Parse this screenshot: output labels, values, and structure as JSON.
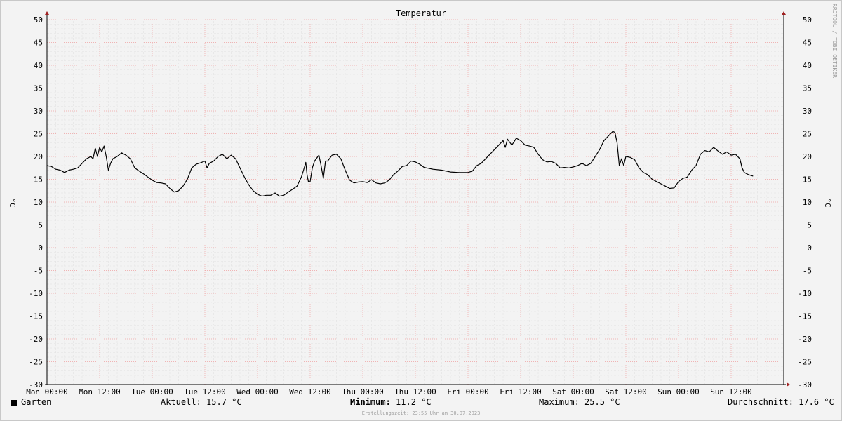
{
  "chart_data": {
    "type": "line",
    "title": "Temperatur",
    "ylabel": "°C",
    "ylabel_right": "°C",
    "watermark": "RRDTOOL / TOBI OETIKER",
    "ylim": [
      -30,
      50
    ],
    "yticks": [
      50,
      45,
      40,
      35,
      30,
      25,
      20,
      15,
      10,
      5,
      0,
      -5,
      -10,
      -15,
      -20,
      -25,
      -30
    ],
    "x_range_hours": [
      0,
      168
    ],
    "xticks": [
      {
        "label": "Mon 00:00",
        "hour": 0
      },
      {
        "label": "Mon 12:00",
        "hour": 12
      },
      {
        "label": "Tue 00:00",
        "hour": 24
      },
      {
        "label": "Tue 12:00",
        "hour": 36
      },
      {
        "label": "Wed 00:00",
        "hour": 48
      },
      {
        "label": "Wed 12:00",
        "hour": 60
      },
      {
        "label": "Thu 00:00",
        "hour": 72
      },
      {
        "label": "Thu 12:00",
        "hour": 84
      },
      {
        "label": "Fri 00:00",
        "hour": 96
      },
      {
        "label": "Fri 12:00",
        "hour": 108
      },
      {
        "label": "Sat 00:00",
        "hour": 120
      },
      {
        "label": "Sat 12:00",
        "hour": 132
      },
      {
        "label": "Sun 00:00",
        "hour": 144
      },
      {
        "label": "Sun 12:00",
        "hour": 156
      }
    ],
    "grid": true,
    "colors": {
      "grid_major": "#f0a0a0",
      "grid_minor": "#e2e2e2",
      "line": "#000000",
      "axis": "#000000",
      "arrow": "#a02020"
    },
    "series": [
      {
        "name": "Garten",
        "points": [
          [
            0,
            18.0
          ],
          [
            1,
            17.8
          ],
          [
            2,
            17.2
          ],
          [
            3,
            17.0
          ],
          [
            4,
            16.5
          ],
          [
            5,
            17.0
          ],
          [
            6,
            17.2
          ],
          [
            7,
            17.5
          ],
          [
            8,
            18.5
          ],
          [
            9,
            19.5
          ],
          [
            10,
            20.0
          ],
          [
            10.5,
            19.5
          ],
          [
            11,
            21.8
          ],
          [
            11.5,
            20.0
          ],
          [
            12,
            22.0
          ],
          [
            12.5,
            21.0
          ],
          [
            13,
            22.3
          ],
          [
            13.5,
            20.0
          ],
          [
            14,
            17.0
          ],
          [
            14.5,
            18.5
          ],
          [
            15,
            19.5
          ],
          [
            16,
            20.0
          ],
          [
            17,
            20.8
          ],
          [
            18,
            20.3
          ],
          [
            19,
            19.5
          ],
          [
            20,
            17.5
          ],
          [
            21,
            16.8
          ],
          [
            22,
            16.2
          ],
          [
            23,
            15.5
          ],
          [
            24,
            14.8
          ],
          [
            25,
            14.3
          ],
          [
            26,
            14.2
          ],
          [
            27,
            14.0
          ],
          [
            28,
            13.0
          ],
          [
            29,
            12.2
          ],
          [
            30,
            12.5
          ],
          [
            31,
            13.5
          ],
          [
            32,
            15.0
          ],
          [
            33,
            17.5
          ],
          [
            34,
            18.3
          ],
          [
            35,
            18.6
          ],
          [
            36,
            19.0
          ],
          [
            36.5,
            17.5
          ],
          [
            37,
            18.5
          ],
          [
            38,
            19.0
          ],
          [
            39,
            20.0
          ],
          [
            40,
            20.5
          ],
          [
            41,
            19.5
          ],
          [
            42,
            20.3
          ],
          [
            43,
            19.5
          ],
          [
            44,
            17.5
          ],
          [
            45,
            15.5
          ],
          [
            46,
            13.8
          ],
          [
            47,
            12.5
          ],
          [
            48,
            11.7
          ],
          [
            49,
            11.3
          ],
          [
            50,
            11.5
          ],
          [
            51,
            11.5
          ],
          [
            52,
            12.0
          ],
          [
            53,
            11.3
          ],
          [
            54,
            11.5
          ],
          [
            55,
            12.2
          ],
          [
            56,
            12.8
          ],
          [
            57,
            13.5
          ],
          [
            58,
            15.5
          ],
          [
            58.5,
            17.0
          ],
          [
            59,
            18.7
          ],
          [
            59.3,
            16.0
          ],
          [
            59.6,
            14.5
          ],
          [
            60,
            14.5
          ],
          [
            60.5,
            17.5
          ],
          [
            61,
            19.0
          ],
          [
            62,
            20.3
          ],
          [
            62.5,
            18.0
          ],
          [
            63,
            15.2
          ],
          [
            63.5,
            19.0
          ],
          [
            64,
            19.0
          ],
          [
            65,
            20.3
          ],
          [
            66,
            20.5
          ],
          [
            67,
            19.5
          ],
          [
            68,
            17.0
          ],
          [
            69,
            14.8
          ],
          [
            70,
            14.2
          ],
          [
            71,
            14.4
          ],
          [
            72,
            14.5
          ],
          [
            73,
            14.3
          ],
          [
            74,
            14.9
          ],
          [
            75,
            14.2
          ],
          [
            76,
            14.0
          ],
          [
            77,
            14.2
          ],
          [
            78,
            14.8
          ],
          [
            79,
            16.0
          ],
          [
            80,
            16.8
          ],
          [
            81,
            17.8
          ],
          [
            82,
            18.0
          ],
          [
            83,
            19.0
          ],
          [
            84,
            18.8
          ],
          [
            85,
            18.3
          ],
          [
            86,
            17.6
          ],
          [
            88,
            17.2
          ],
          [
            90,
            17.0
          ],
          [
            92,
            16.6
          ],
          [
            94,
            16.5
          ],
          [
            96,
            16.5
          ],
          [
            97,
            16.8
          ],
          [
            98,
            18.0
          ],
          [
            99,
            18.5
          ],
          [
            100,
            19.5
          ],
          [
            101,
            20.5
          ],
          [
            102,
            21.5
          ],
          [
            103,
            22.5
          ],
          [
            104,
            23.5
          ],
          [
            104.5,
            22.0
          ],
          [
            105,
            23.8
          ],
          [
            106,
            22.5
          ],
          [
            107,
            24.0
          ],
          [
            108,
            23.5
          ],
          [
            109,
            22.5
          ],
          [
            110,
            22.3
          ],
          [
            111,
            22.0
          ],
          [
            112,
            20.5
          ],
          [
            113,
            19.3
          ],
          [
            114,
            18.8
          ],
          [
            115,
            18.9
          ],
          [
            116,
            18.5
          ],
          [
            117,
            17.5
          ],
          [
            118,
            17.6
          ],
          [
            119,
            17.5
          ],
          [
            120,
            17.7
          ],
          [
            121,
            18.0
          ],
          [
            122,
            18.5
          ],
          [
            123,
            18.0
          ],
          [
            124,
            18.5
          ],
          [
            125,
            20.0
          ],
          [
            126,
            21.5
          ],
          [
            127,
            23.5
          ],
          [
            128,
            24.5
          ],
          [
            129,
            25.5
          ],
          [
            129.5,
            25.3
          ],
          [
            130,
            23.0
          ],
          [
            130.5,
            18.0
          ],
          [
            131,
            19.5
          ],
          [
            131.5,
            18.0
          ],
          [
            132,
            20.0
          ],
          [
            133,
            19.8
          ],
          [
            134,
            19.3
          ],
          [
            135,
            17.5
          ],
          [
            136,
            16.5
          ],
          [
            137,
            16.0
          ],
          [
            138,
            15.0
          ],
          [
            139,
            14.5
          ],
          [
            140,
            14.0
          ],
          [
            141,
            13.5
          ],
          [
            142,
            13.0
          ],
          [
            143,
            13.1
          ],
          [
            144,
            14.5
          ],
          [
            145,
            15.2
          ],
          [
            146,
            15.5
          ],
          [
            147,
            17.0
          ],
          [
            148,
            18.0
          ],
          [
            149,
            20.5
          ],
          [
            150,
            21.3
          ],
          [
            151,
            21.0
          ],
          [
            152,
            22.0
          ],
          [
            153,
            21.2
          ],
          [
            154,
            20.5
          ],
          [
            155,
            21.0
          ],
          [
            156,
            20.3
          ],
          [
            157,
            20.5
          ],
          [
            158,
            19.5
          ],
          [
            158.5,
            17.5
          ],
          [
            159,
            16.5
          ],
          [
            160,
            16.0
          ],
          [
            161,
            15.7
          ]
        ]
      }
    ],
    "legend": {
      "series_label": "Garten",
      "current": "Aktuell: 15.7 °C",
      "minimum_key": "Minimum:",
      "minimum_value": "11.2 °C",
      "maximum": "Maximum: 25.5 °C",
      "average": "Durchschnitt: 17.6 °C"
    },
    "footer": "Erstellungszeit: 23:55 Uhr am 30.07.2023"
  }
}
